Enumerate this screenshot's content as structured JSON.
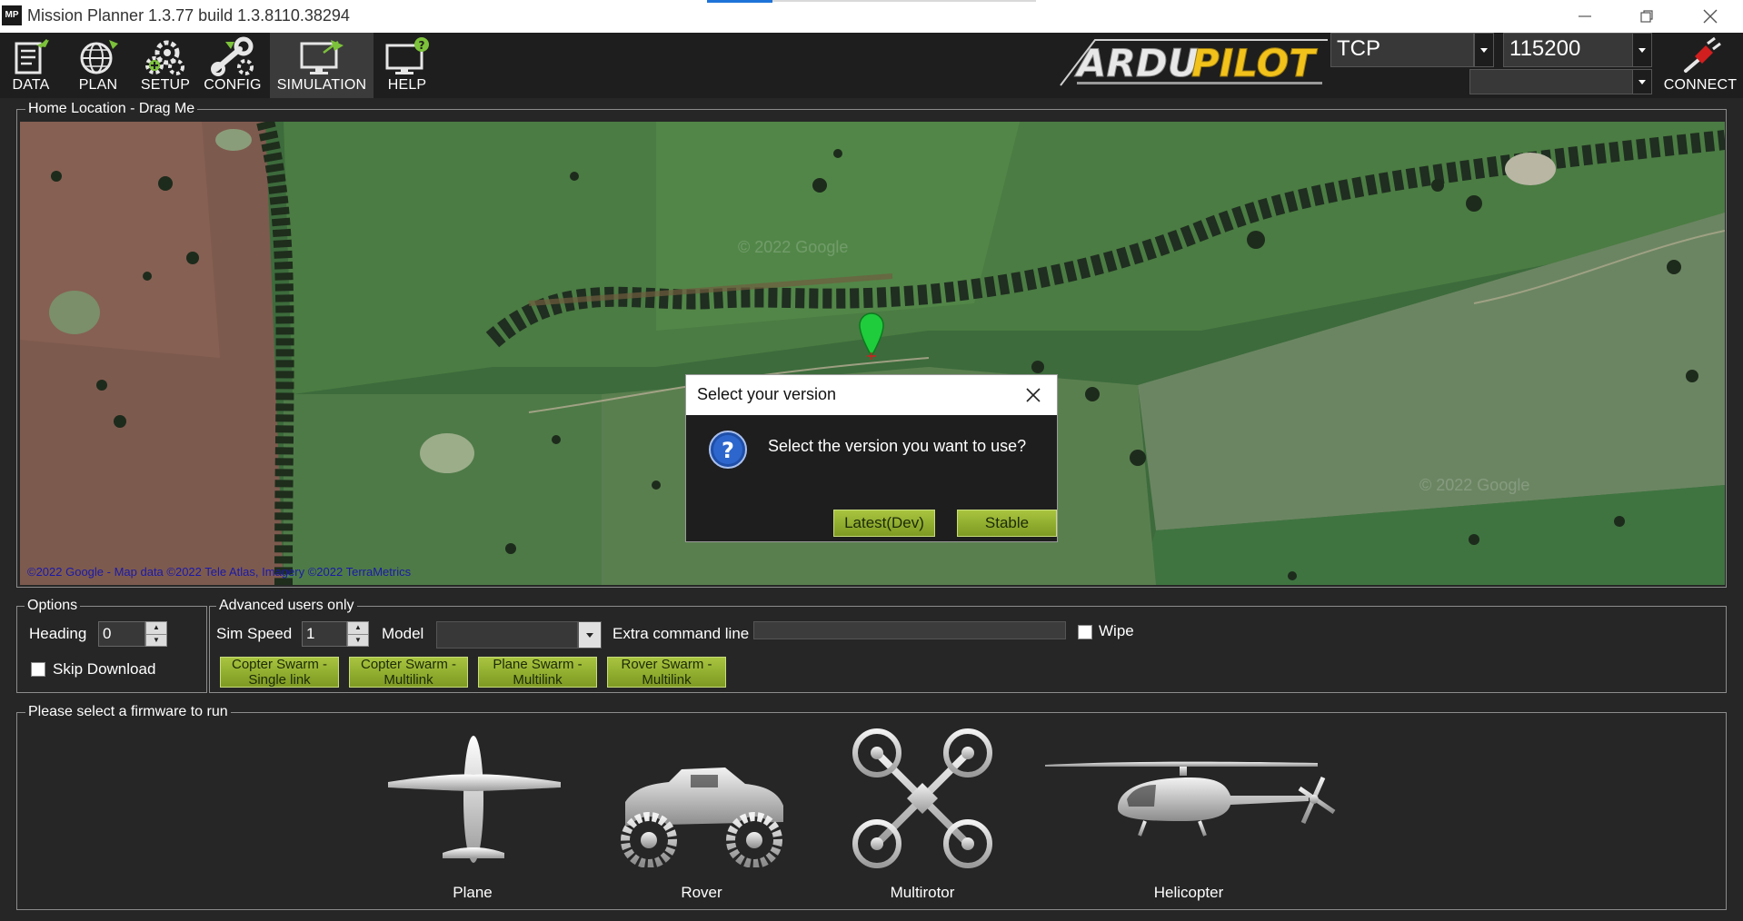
{
  "window": {
    "title": "Mission Planner 1.3.77 build 1.3.8110.38294",
    "app_icon_text": "MP",
    "controls": [
      "minimize-icon",
      "restore-icon",
      "close-icon"
    ]
  },
  "toolbar": {
    "buttons": [
      {
        "label": "DATA",
        "icon": "data-icon"
      },
      {
        "label": "PLAN",
        "icon": "plan-globe-icon"
      },
      {
        "label": "SETUP",
        "icon": "setup-gears-icon"
      },
      {
        "label": "CONFIG",
        "icon": "config-wrench-icon"
      },
      {
        "label": "SIMULATION",
        "icon": "simulation-monitor-icon",
        "active": true
      },
      {
        "label": "HELP",
        "icon": "help-monitor-icon"
      }
    ],
    "logo": {
      "part1": "ARDU",
      "part2": "PILOT"
    },
    "connection_type": "TCP",
    "baud_rate": "115200",
    "port_value": "",
    "connect_label": "CONNECT"
  },
  "map_group": {
    "label": "Home Location - Drag Me",
    "attribution": "©2022 Google - Map data ©2022 Tele Atlas, Imagery ©2022 TerraMetrics",
    "watermark": "© 2022 Google"
  },
  "dialog": {
    "title": "Select your version",
    "message": "Select the version you want to use?",
    "buttons": [
      "Latest(Dev)",
      "Stable"
    ]
  },
  "options": {
    "label": "Options",
    "heading_label": "Heading",
    "heading_value": "0",
    "skip_download_label": "Skip Download",
    "skip_download_checked": false
  },
  "advanced": {
    "label": "Advanced users only",
    "sim_speed_label": "Sim Speed",
    "sim_speed_value": "1",
    "model_label": "Model",
    "model_value": "",
    "extra_cmd_label": "Extra command line",
    "extra_cmd_value": "",
    "wipe_label": "Wipe",
    "wipe_checked": false,
    "swarm_buttons": [
      {
        "line1": "Copter Swarm -",
        "line2": "Single link"
      },
      {
        "line1": "Copter Swarm -",
        "line2": "Multilink"
      },
      {
        "line1": "Plane Swarm -",
        "line2": "Multilink"
      },
      {
        "line1": "Rover Swarm -",
        "line2": "Multilink"
      }
    ]
  },
  "firmware": {
    "label": "Please select a firmware to run",
    "items": [
      {
        "name": "Plane",
        "icon": "plane-icon"
      },
      {
        "name": "Rover",
        "icon": "rover-icon"
      },
      {
        "name": "Multirotor",
        "icon": "multirotor-icon"
      },
      {
        "name": "Helicopter",
        "icon": "helicopter-icon"
      }
    ]
  },
  "colors": {
    "background": "#262626",
    "toolbar": "#1e1e1e",
    "accent_green": "#9cba38",
    "map_marker": "#22cc44"
  }
}
